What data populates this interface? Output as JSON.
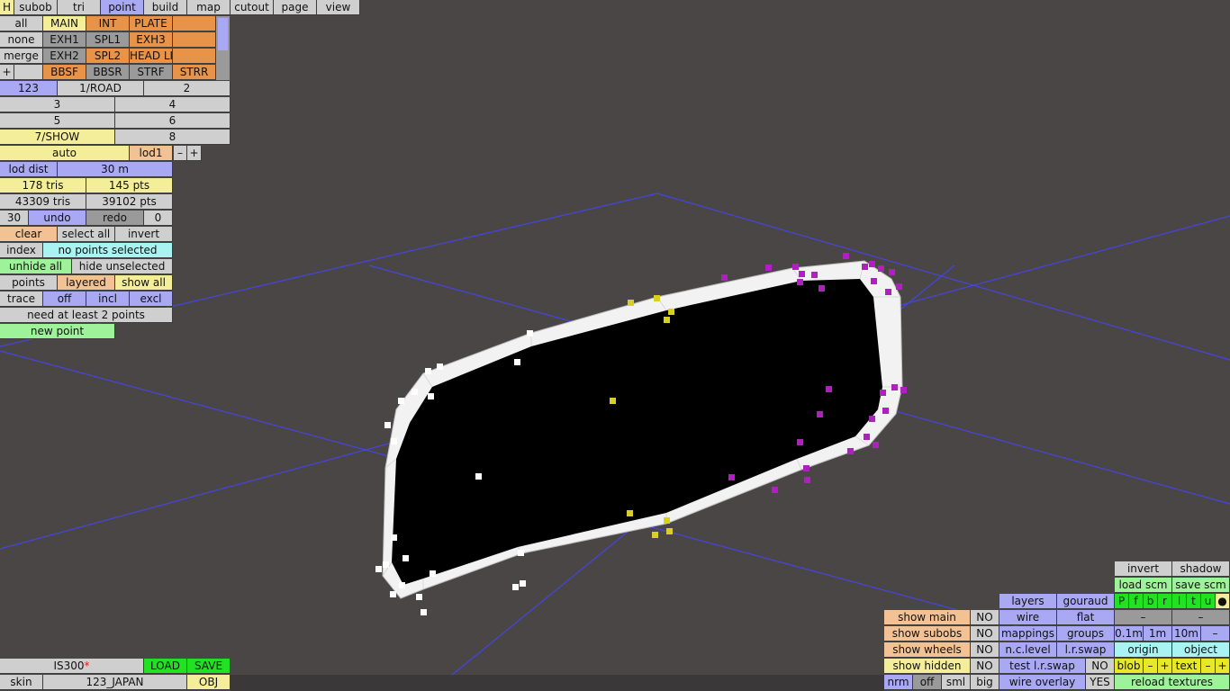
{
  "menu": {
    "h": "H",
    "tabs": [
      "subob",
      "tri",
      "point",
      "build",
      "map",
      "cutout",
      "page",
      "view"
    ],
    "active": "point"
  },
  "sel": {
    "all": "all",
    "none": "none",
    "merge": "merge",
    "plus": "+"
  },
  "subobs": {
    "r1": [
      "MAIN",
      "INT",
      "PLATE",
      ""
    ],
    "r2": [
      "EXH1",
      "SPL1",
      "EXH3",
      ""
    ],
    "r3": [
      "EXH2",
      "SPL2",
      "HEAD LI",
      ""
    ],
    "r4": [
      "",
      "BBSF",
      "BBSR",
      "STRF",
      "STRR"
    ]
  },
  "layers": {
    "l123": "123",
    "road": "1/ROAD",
    "l2": "2",
    "l3": "3",
    "l4": "4",
    "l5": "5",
    "l6": "6",
    "show": "7/SHOW",
    "l8": "8"
  },
  "lod": {
    "auto": "auto",
    "lod1": "lod1",
    "minus": "–",
    "plus": "+",
    "dist_label": "lod dist",
    "dist": "30 m"
  },
  "stats": {
    "tris": "178 tris",
    "pts": "145 pts",
    "ttris": "43309 tris",
    "tpts": "39102 pts"
  },
  "undo": {
    "n": "30",
    "undo": "undo",
    "redo": "redo",
    "r": "0"
  },
  "select": {
    "clear": "clear",
    "all": "select all",
    "invert": "invert"
  },
  "index": {
    "label": "index",
    "status": "no points selected"
  },
  "hide": {
    "unhide": "unhide all",
    "hideun": "hide unselected"
  },
  "points": {
    "label": "points",
    "layered": "layered",
    "showall": "show all"
  },
  "trace": {
    "label": "trace",
    "off": "off",
    "incl": "incl",
    "excl": "excl"
  },
  "need": "need at least 2 points",
  "newpoint": "new point",
  "car": {
    "name": "IS300",
    "mod": "*",
    "load": "LOAD",
    "save": "SAVE",
    "skin": "skin",
    "skinval": "123_JAPAN",
    "obj": "OBJ"
  },
  "right": {
    "invert": "invert",
    "shadow": "shadow",
    "loadscm": "load scm",
    "savescm": "save scm",
    "flags": [
      "P",
      "f",
      "b",
      "r",
      "l",
      "t",
      "u",
      "●"
    ],
    "dash": "–",
    "layers": "layers",
    "gouraud": "gouraud",
    "wire": "wire",
    "flat": "flat",
    "mappings": "mappings",
    "groups": "groups",
    "m01": "0.1m",
    "m1": "1m",
    "m10": "10m",
    "nclevel": "n.c.level",
    "lrswap": "l.r.swap",
    "origin": "origin",
    "object": "object",
    "testlr": "test l.r.swap",
    "no": "NO",
    "blob": "blob",
    "text": "text",
    "minus": "–",
    "plus": "+",
    "wireov": "wire overlay",
    "yes": "YES",
    "reload": "reload textures",
    "showmain": "show main",
    "showsubobs": "show subobs",
    "showwheels": "show wheels",
    "showhidden": "show hidden",
    "nrm": "nrm",
    "off": "off",
    "sml": "sml",
    "big": "big"
  },
  "colors": {
    "bg": "#4a4646",
    "grid": "#4545e0",
    "mesh": "#f2f2f2",
    "hole": "#000000",
    "pt_white": "#ffffff",
    "pt_yellow": "#d7d020",
    "pt_magenta": "#b020c0"
  }
}
